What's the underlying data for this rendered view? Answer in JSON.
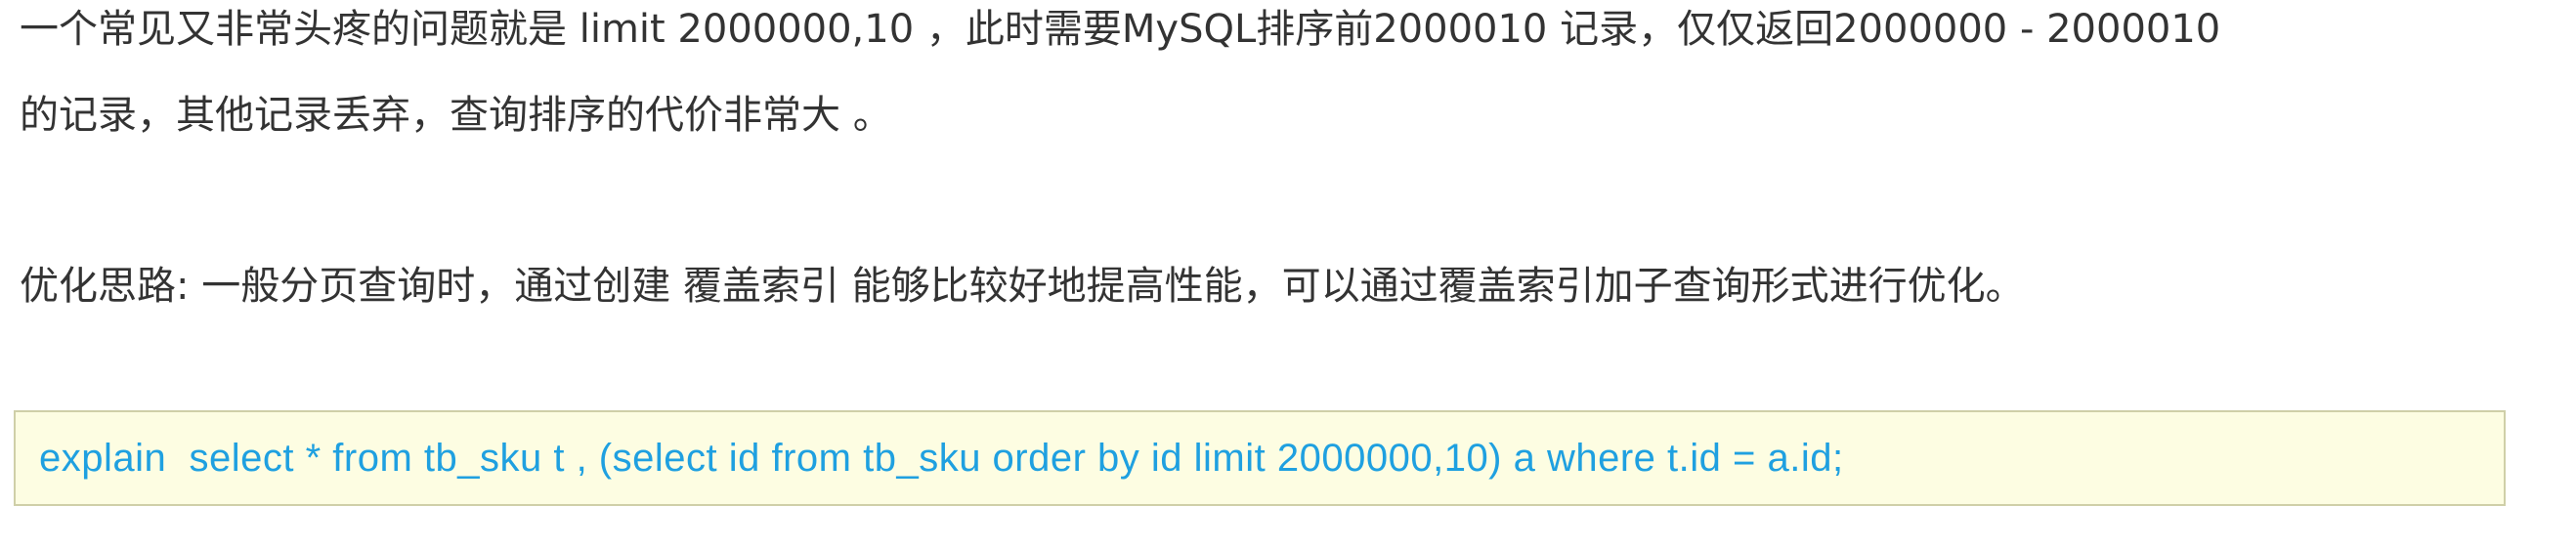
{
  "paragraph1": {
    "line1": "一个常见又非常头疼的问题就是 limit 2000000,10 ，此时需要MySQL排序前2000010 记录，仅仅返回2000000 - 2000010",
    "line2": "的记录，其他记录丢弃，查询排序的代价非常大 。"
  },
  "paragraph2": {
    "text": "优化思路: 一般分页查询时，通过创建 覆盖索引 能够比较好地提高性能，可以通过覆盖索引加子查询形式进行优化。"
  },
  "code_block": {
    "code": "explain  select * from tb_sku t , (select id from tb_sku order by id limit 2000000,10) a where t.id = a.id;"
  },
  "colors": {
    "text": "#333333",
    "code_text": "#1fa0e0",
    "code_background": "#fdfde2",
    "code_border": "#cfcfa8"
  }
}
